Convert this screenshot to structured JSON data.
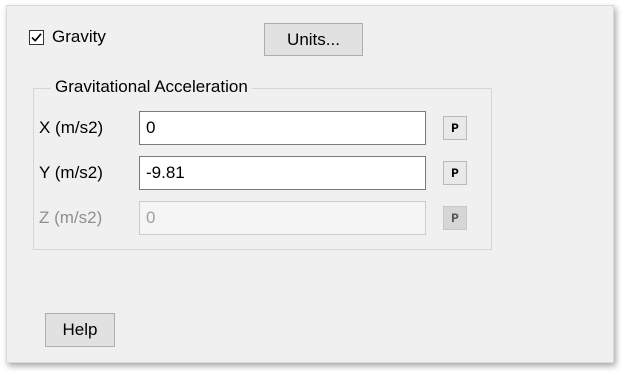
{
  "gravity": {
    "label": "Gravity",
    "checked": true
  },
  "units_button": {
    "label": "Units..."
  },
  "group": {
    "title": "Gravitational Acceleration",
    "fields": [
      {
        "label": "X (m/s2)",
        "value": "0",
        "param_label": "P",
        "enabled": true
      },
      {
        "label": "Y (m/s2)",
        "value": "-9.81",
        "param_label": "P",
        "enabled": true
      },
      {
        "label": "Z (m/s2)",
        "value": "0",
        "param_label": "P",
        "enabled": false
      }
    ]
  },
  "help_button": {
    "label": "Help"
  },
  "colors": {
    "panel_bg": "#f0f0f0",
    "button_bg": "#e1e1e1",
    "disabled_text": "#8f8f8f"
  }
}
